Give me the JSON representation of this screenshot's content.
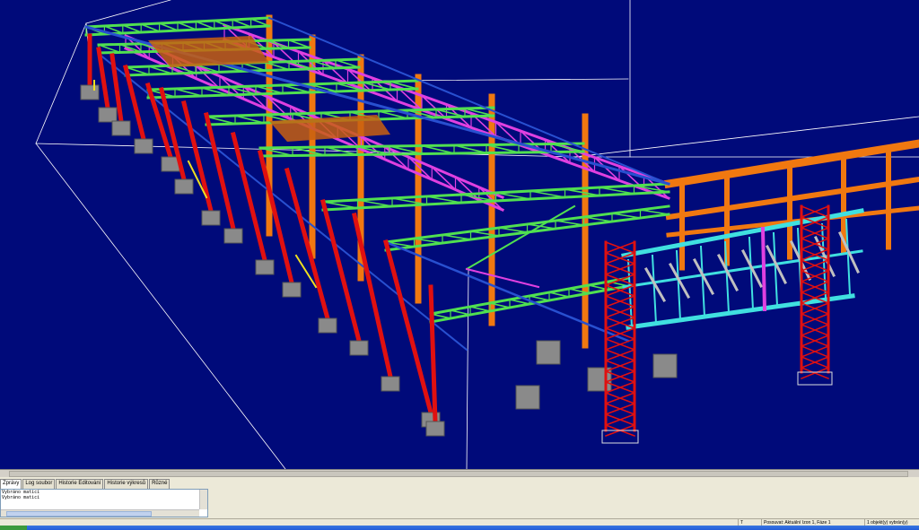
{
  "viewport": {
    "background": "#000a7a",
    "grid_color": "#ffffff",
    "member_colors": {
      "column": "#e01010",
      "rafter_truss": "#e040e0",
      "purlin_truss": "#50e050",
      "brace": "#2850d0",
      "existing_building": "#f07810",
      "canopy": "#40e0e0",
      "tower": "#e01010",
      "footing": "#8a8a8a",
      "deck": "#c86010"
    }
  },
  "message_pane": {
    "tabs": [
      {
        "label": "Zprávy"
      },
      {
        "label": "Log soubor"
      },
      {
        "label": "Historie Editování"
      },
      {
        "label": "Historie výkresů"
      },
      {
        "label": "Různé"
      }
    ],
    "lines": [
      "Vybráno maticí",
      "Vybráno maticí"
    ]
  },
  "statusbar": {
    "mode": "T",
    "info": "Posouvat: Aktuální Izon 1, Fáze 1",
    "selection": "1 objekt(y) vybrán(y)"
  }
}
